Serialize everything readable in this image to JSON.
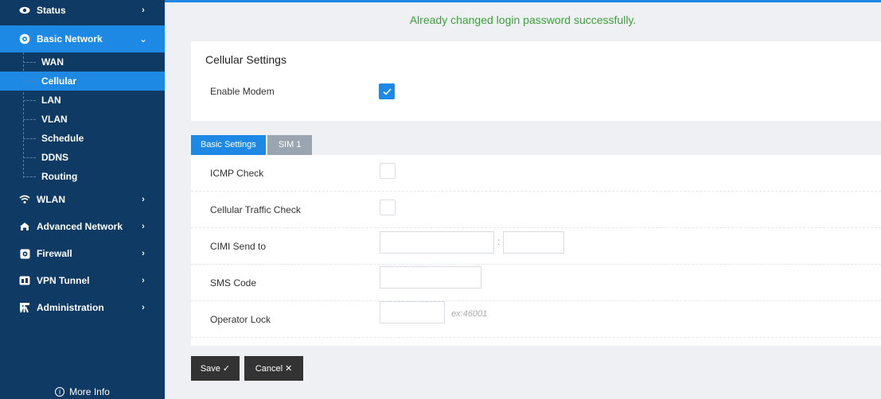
{
  "sidebar": {
    "items": [
      {
        "label": "Status",
        "icon": "eye-icon",
        "chevron": "›"
      },
      {
        "label": "Basic Network",
        "icon": "globe-icon",
        "chevron": "⌄"
      },
      {
        "label": "WLAN",
        "icon": "wifi-icon",
        "chevron": "›"
      },
      {
        "label": "Advanced Network",
        "icon": "network-icon",
        "chevron": "›"
      },
      {
        "label": "Firewall",
        "icon": "firewall-icon",
        "chevron": "›"
      },
      {
        "label": "VPN Tunnel",
        "icon": "vpn-icon",
        "chevron": "›"
      },
      {
        "label": "Administration",
        "icon": "admin-icon",
        "chevron": "›"
      }
    ],
    "subitems": [
      "WAN",
      "Cellular",
      "LAN",
      "VLAN",
      "Schedule",
      "DDNS",
      "Routing"
    ],
    "more_info": "More Info",
    "colors": {
      "background": "#0e3a64",
      "active": "#1e88e5"
    }
  },
  "message": "Already changed login password successfully.",
  "cellular": {
    "title": "Cellular Settings",
    "enable_modem_label": "Enable Modem",
    "enable_modem_checked": true
  },
  "tabs": [
    "Basic Settings",
    "SIM 1"
  ],
  "form": {
    "icmp_check_label": "ICMP Check",
    "traffic_check_label": "Cellular Traffic Check",
    "cimi_label": "CIMI Send to",
    "cimi_separator": ":",
    "sms_label": "SMS Code",
    "operator_label": "Operator Lock",
    "operator_hint": "ex:46001"
  },
  "buttons": {
    "save": "Save",
    "save_icon": "✓",
    "cancel": "Cancel",
    "cancel_icon": "✕"
  }
}
